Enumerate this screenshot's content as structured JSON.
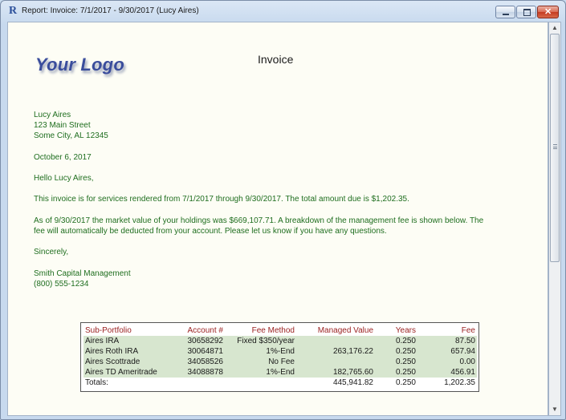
{
  "window": {
    "title": "Report: Invoice: 7/1/2017 - 9/30/2017 (Lucy Aires)",
    "app_icon_letter": "R"
  },
  "report": {
    "logo_text": "Your Logo",
    "heading": "Invoice",
    "address": [
      "Lucy Aires",
      "123 Main Street",
      "Some City, AL 12345"
    ],
    "date": "October 6, 2017",
    "greeting": "Hello Lucy Aires,",
    "paragraph1": "This invoice is for services rendered from 7/1/2017 through 9/30/2017.  The total amount due is $1,202.35.",
    "paragraph2_line1": "As of 9/30/2017 the market value of your holdings was $669,107.71.  A breakdown of the management fee is shown below.  The",
    "paragraph2_line2": "fee will automatically be deducted from your account.  Please let us know if you have any questions.",
    "closing": "Sincerely,",
    "signature": [
      "Smith Capital Management",
      "(800) 555-1234"
    ]
  },
  "fee_table": {
    "headers": [
      "Sub-Portfolio",
      "Account #",
      "Fee Method",
      "Managed Value",
      "Years",
      "Fee"
    ],
    "rows": [
      [
        "Aires IRA",
        "30658292",
        "Fixed $350/year",
        "",
        "0.250",
        "87.50"
      ],
      [
        "Aires Roth IRA",
        "30064871",
        "1%-End",
        "263,176.22",
        "0.250",
        "657.94"
      ],
      [
        "Aires Scottrade",
        "34058526",
        "No Fee",
        "",
        "0.250",
        "0.00"
      ],
      [
        "Aires TD Ameritrade",
        "34088878",
        "1%-End",
        "182,765.60",
        "0.250",
        "456.91"
      ]
    ],
    "totals": [
      "Totals:",
      "",
      "",
      "445,941.82",
      "0.250",
      "1,202.35"
    ]
  },
  "colors": {
    "body_text": "#1f6e1f",
    "header_text": "#9a1f1f",
    "row_shade": "#d7e6cf",
    "page_background": "#fdfdf5",
    "logo": "#3a4d9c"
  },
  "icons": {
    "minimize": "minimize-icon",
    "maximize": "maximize-icon",
    "close": "close-icon",
    "scroll_up": "scroll-up-arrow-icon",
    "scroll_down": "scroll-down-arrow-icon"
  }
}
